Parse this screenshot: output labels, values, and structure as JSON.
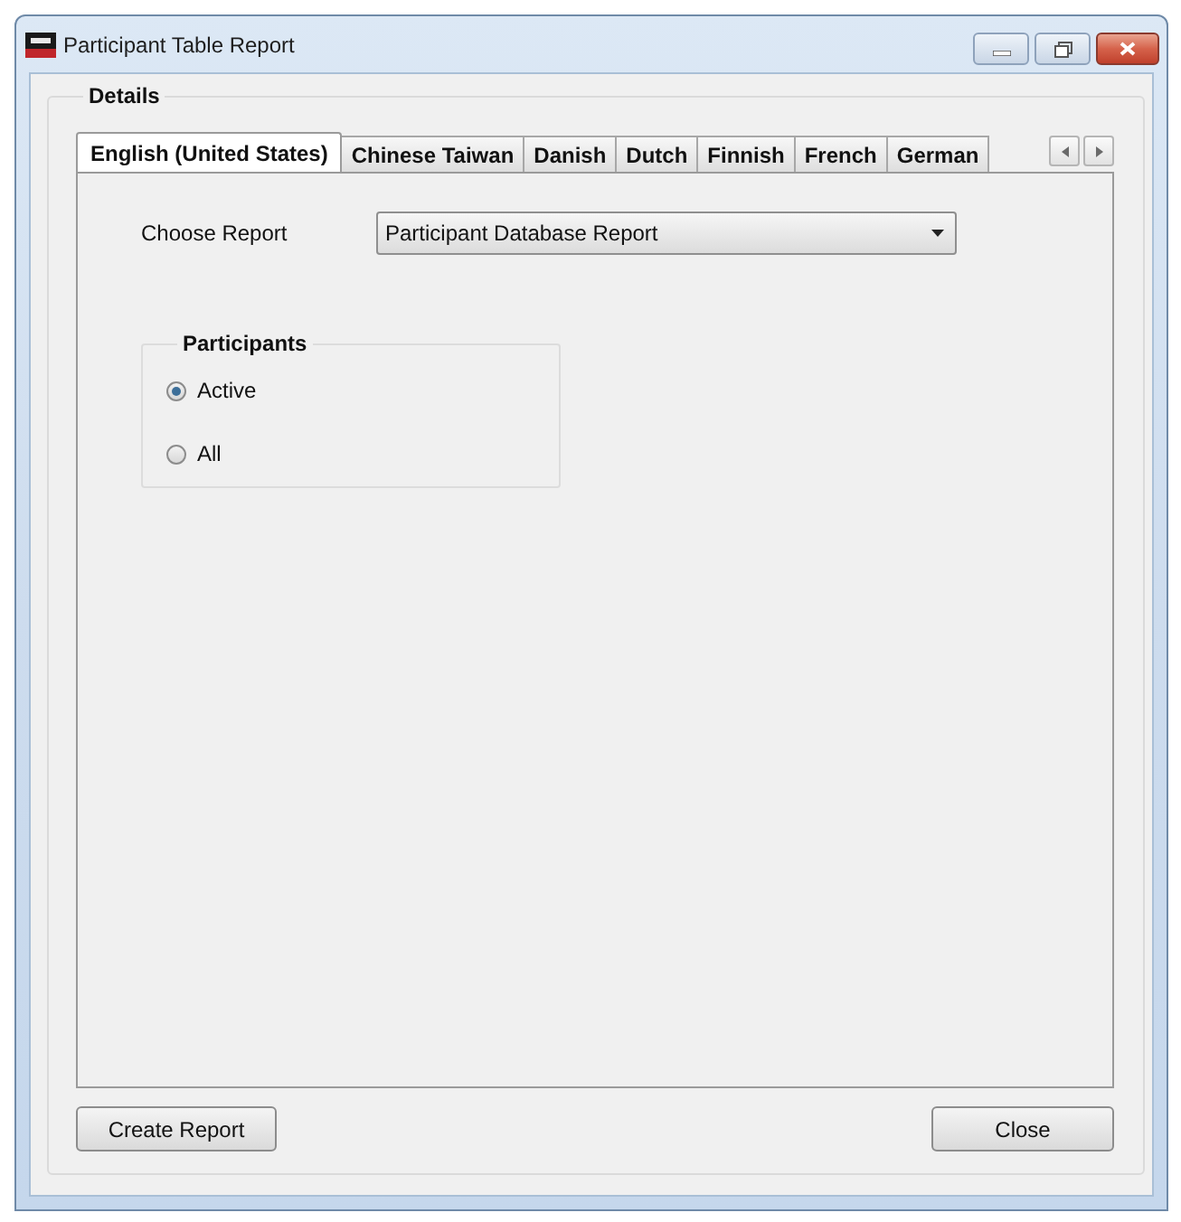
{
  "window": {
    "title": "Participant Table Report"
  },
  "details": {
    "title": "Details",
    "tabs": [
      {
        "label": "English (United States)",
        "selected": true
      },
      {
        "label": "Chinese Taiwan",
        "selected": false
      },
      {
        "label": "Danish",
        "selected": false
      },
      {
        "label": "Dutch",
        "selected": false
      },
      {
        "label": "Finnish",
        "selected": false
      },
      {
        "label": "French",
        "selected": false
      },
      {
        "label": "German",
        "selected": false
      }
    ]
  },
  "report": {
    "label": "Choose Report",
    "value": "Participant Database Report"
  },
  "participants": {
    "title": "Participants",
    "options": [
      {
        "label": "Active",
        "selected": true
      },
      {
        "label": "All",
        "selected": false
      }
    ]
  },
  "buttons": [
    {
      "label": "Create Report"
    },
    {
      "label": "Close"
    }
  ]
}
